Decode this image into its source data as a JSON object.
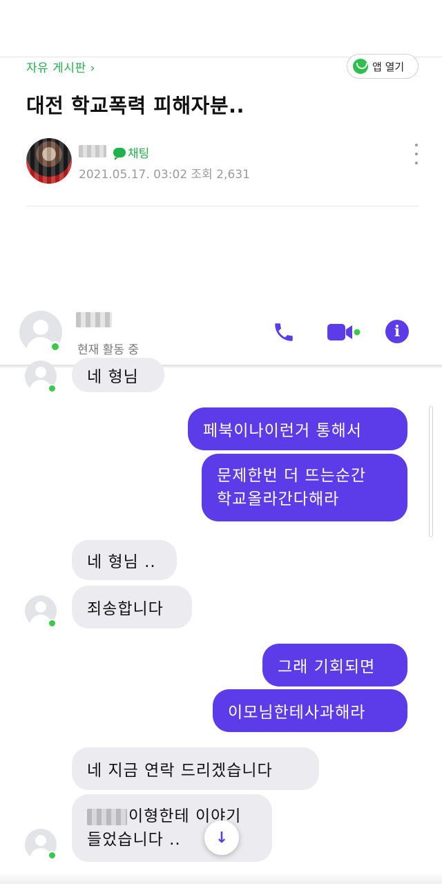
{
  "board": {
    "link_label": "자유 게시판",
    "chevron": "›",
    "app_open_label": "앱 열기",
    "app_logo_icon": "green-smile-logo-icon",
    "title": "대전 학교폭력 피해자분..",
    "chat_label": "채팅",
    "meta": "2021.05.17. 03:02  조회 2,631"
  },
  "messenger": {
    "status": "현재 활동 중",
    "accent_color": "#5b3ce8",
    "online_color": "#3cc94a",
    "icons": [
      "phone-icon",
      "video-camera-icon",
      "info-icon"
    ],
    "info_glyph": "i"
  },
  "messages": {
    "m1": "네 형님",
    "m2": "페북이나이런거 통해서",
    "m3_line1": "문제한번 더 뜨는순간",
    "m3_line2": "학교올라간다해라",
    "m4": "네 형님 ..",
    "m5": "죄송합니다",
    "m6": "그래 기회되면",
    "m7": "이모님한테사과해라",
    "m8": "네 지금 연락 드리겠습니다",
    "m9_line1": "이형한테 이야기",
    "m9_line2": "들었습니다 .."
  },
  "scroll_down_icon": "↓"
}
